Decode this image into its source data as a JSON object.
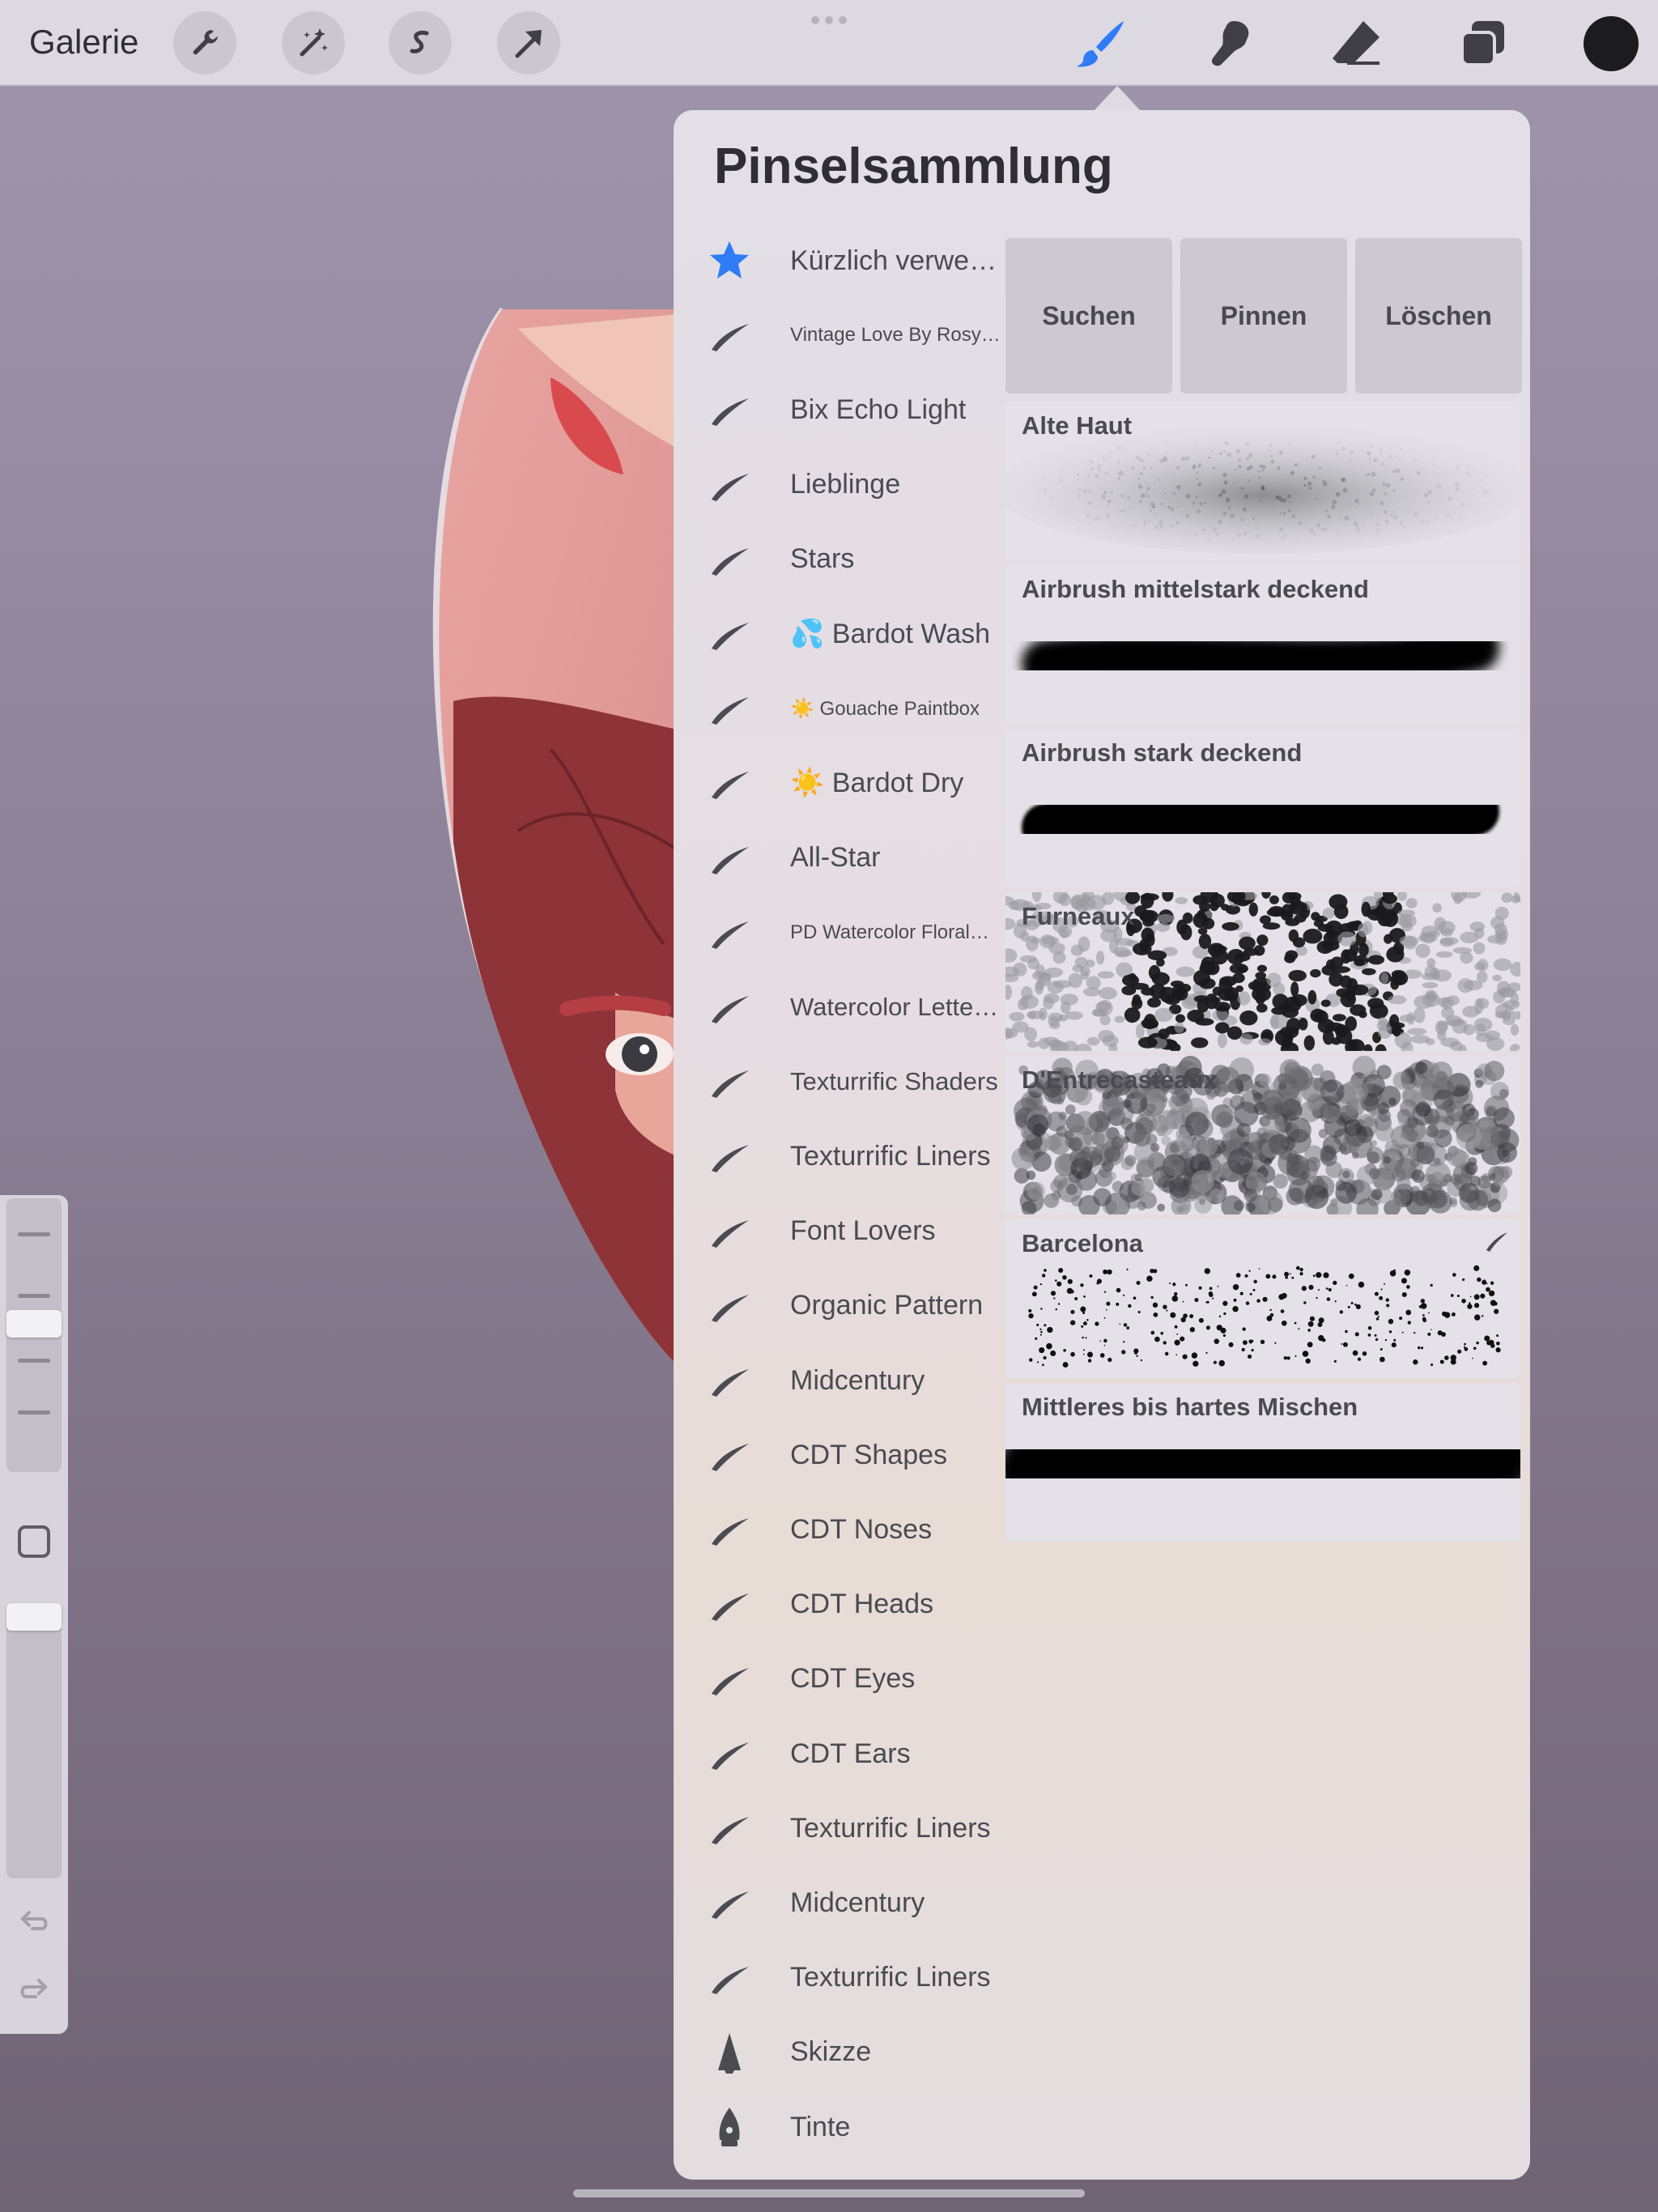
{
  "toolbar": {
    "gallery_label": "Galerie",
    "left_tools": [
      "wrench-icon",
      "magic-wand-icon",
      "selection-s-icon",
      "transform-arrow-icon"
    ],
    "right_tools": [
      "brush-icon",
      "smudge-icon",
      "eraser-icon",
      "layers-icon"
    ],
    "active_tool": "brush-icon",
    "accent_color": "#2f7cf6",
    "current_color": "#1c1c1e"
  },
  "panel": {
    "title": "Pinselsammlung",
    "actions": [
      "Suchen",
      "Pinnen",
      "Löschen"
    ],
    "sets": [
      {
        "icon": "star-icon",
        "label": "Kürzlich verwendet",
        "size": "normal"
      },
      {
        "icon": "brush-stroke-icon",
        "label": "Vintage Love By Rosy…",
        "size": "small"
      },
      {
        "icon": "brush-stroke-icon",
        "label": "Bix Echo Light",
        "size": "normal"
      },
      {
        "icon": "brush-stroke-icon",
        "label": "Lieblinge",
        "size": "normal"
      },
      {
        "icon": "brush-stroke-icon",
        "label": "Stars",
        "size": "normal"
      },
      {
        "icon": "brush-stroke-icon",
        "label": "💦 Bardot Wash",
        "size": "normal"
      },
      {
        "icon": "brush-stroke-icon",
        "label": "☀️ Gouache Paintbox",
        "size": "small"
      },
      {
        "icon": "brush-stroke-icon",
        "label": "☀️ Bardot Dry",
        "size": "normal"
      },
      {
        "icon": "brush-stroke-icon",
        "label": "All-Star",
        "size": "normal"
      },
      {
        "icon": "brush-stroke-icon",
        "label": "PD Watercolor Floral…",
        "size": "small"
      },
      {
        "icon": "brush-stroke-icon",
        "label": "Watercolor Lettering",
        "size": "medium"
      },
      {
        "icon": "brush-stroke-icon",
        "label": "Texturrific Shaders",
        "size": "medium"
      },
      {
        "icon": "brush-stroke-icon",
        "label": "Texturrific Liners",
        "size": "normal"
      },
      {
        "icon": "brush-stroke-icon",
        "label": "Font Lovers",
        "size": "normal"
      },
      {
        "icon": "brush-stroke-icon",
        "label": "Organic Pattern",
        "size": "normal"
      },
      {
        "icon": "brush-stroke-icon",
        "label": "Midcentury",
        "size": "normal"
      },
      {
        "icon": "brush-stroke-icon",
        "label": "CDT Shapes",
        "size": "normal"
      },
      {
        "icon": "brush-stroke-icon",
        "label": "CDT Noses",
        "size": "normal"
      },
      {
        "icon": "brush-stroke-icon",
        "label": "CDT Heads",
        "size": "normal"
      },
      {
        "icon": "brush-stroke-icon",
        "label": "CDT Eyes",
        "size": "normal"
      },
      {
        "icon": "brush-stroke-icon",
        "label": "CDT Ears",
        "size": "normal"
      },
      {
        "icon": "brush-stroke-icon",
        "label": "Texturrific Liners",
        "size": "normal"
      },
      {
        "icon": "brush-stroke-icon",
        "label": "Midcentury",
        "size": "normal"
      },
      {
        "icon": "brush-stroke-icon",
        "label": "Texturrific Liners",
        "size": "normal"
      },
      {
        "icon": "pencil-tip-icon",
        "label": "Skizze",
        "size": "normal"
      },
      {
        "icon": "pen-nib-icon",
        "label": "Tinte",
        "size": "normal"
      }
    ],
    "brushes": [
      {
        "name": "Alte Haut",
        "preview": "leather-texture"
      },
      {
        "name": "Airbrush mittelstark deckend",
        "preview": "soft-stroke"
      },
      {
        "name": "Airbrush stark deckend",
        "preview": "hard-stroke"
      },
      {
        "name": "Furneaux",
        "preview": "leopard-texture"
      },
      {
        "name": "D'Entrecasteaux",
        "preview": "grunge-texture"
      },
      {
        "name": "Barcelona",
        "preview": "splatter-texture",
        "imported": true
      },
      {
        "name": "Mittleres bis hartes Mischen",
        "preview": "blend-stroke"
      }
    ]
  }
}
